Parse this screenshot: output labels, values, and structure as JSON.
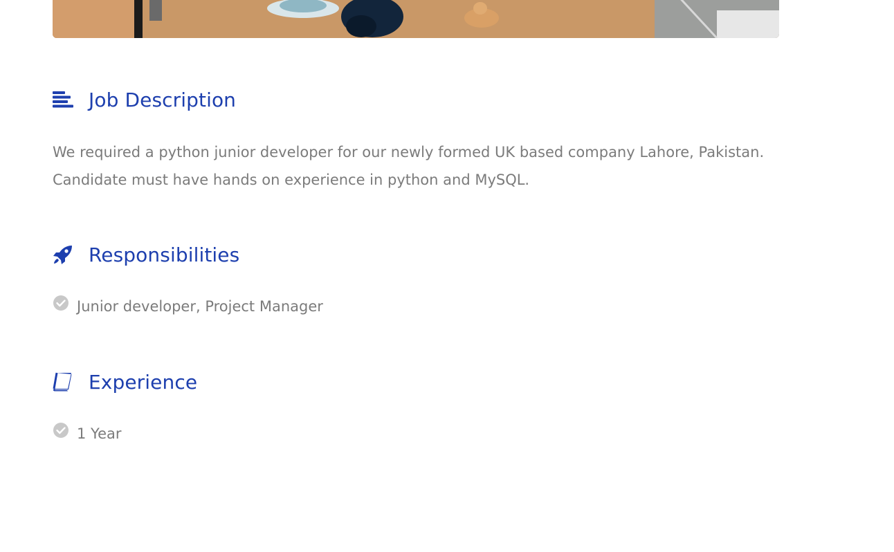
{
  "hero": {
    "alt": "desk workspace photo"
  },
  "job_description": {
    "icon": "align-left-icon",
    "title": "Job Description",
    "text": "We required a python junior developer for our newly formed UK based company Lahore, Pakistan. Candidate must have hands on experience in python and MySQL."
  },
  "responsibilities": {
    "icon": "rocket-icon",
    "title": "Responsibilities",
    "items": [
      {
        "icon": "check-circle-icon",
        "label": "Junior developer, Project Manager"
      }
    ]
  },
  "experience": {
    "icon": "book-icon",
    "title": "Experience",
    "items": [
      {
        "icon": "check-circle-icon",
        "label": "1 Year"
      }
    ]
  },
  "colors": {
    "heading": "#1d3fae",
    "body_text": "#7b7b7b",
    "check_icon": "#c8c8c8"
  }
}
